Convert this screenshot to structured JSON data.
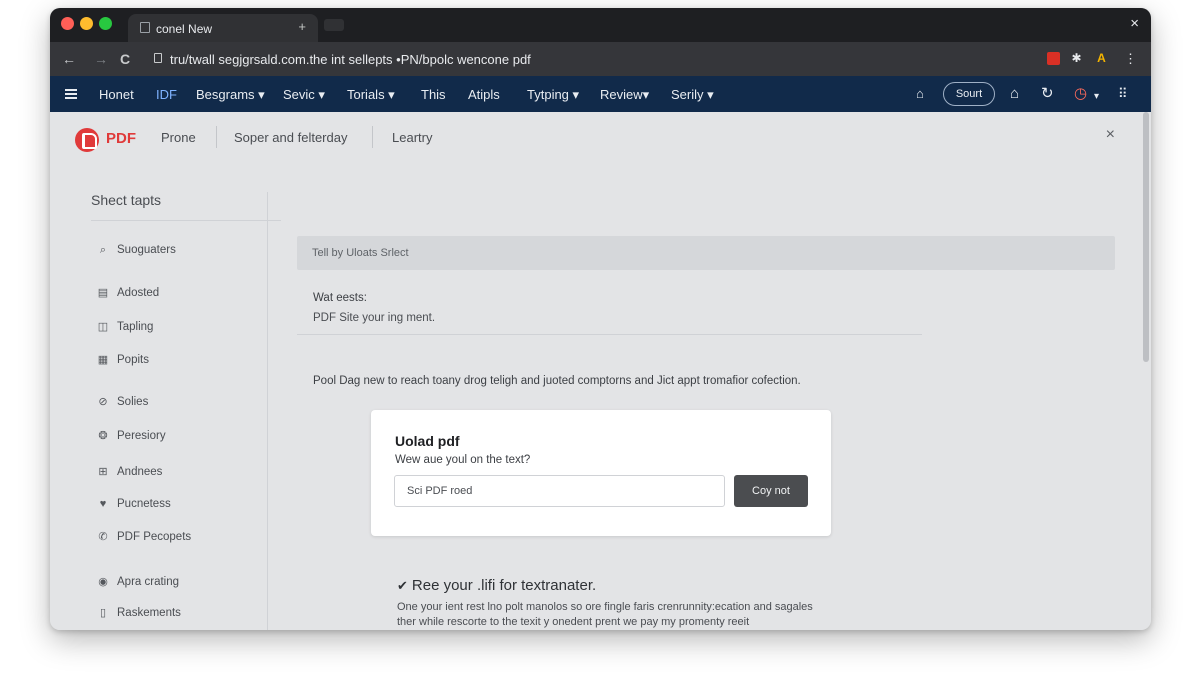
{
  "browser": {
    "tab_title": "conel New",
    "tab_close": "+",
    "window_close": "×",
    "url": "tru/twall segjgrsald.com.the int sellepts •PN/bpolc wencone pdf",
    "nav": {
      "back": "←",
      "forward": "→",
      "reload": "C"
    }
  },
  "site_nav": {
    "items": [
      "Honet",
      "IDF",
      "Besgrams ▾",
      "Sevic ▾",
      "Torials ▾",
      "This",
      "Atipls",
      "Tytping ▾",
      "Review▾",
      "Serily ▾"
    ],
    "search_label": "Sourt"
  },
  "header": {
    "logo_text": "PDF",
    "links": [
      "Prone",
      "Soper and felterday",
      "Leartry"
    ],
    "close": "×"
  },
  "sidebar": {
    "title": "Shect tapts",
    "items": [
      {
        "label": "Suoguaters",
        "icon": "search-icon",
        "glyph": "⌕"
      },
      {
        "label": "Adosted",
        "icon": "document-icon",
        "glyph": "▤"
      },
      {
        "label": "Tapling",
        "icon": "pages-icon",
        "glyph": "◫"
      },
      {
        "label": "Popits",
        "icon": "file-icon",
        "glyph": "▦"
      },
      {
        "label": "Solies",
        "icon": "link-icon",
        "glyph": "⊘"
      },
      {
        "label": "Peresiory",
        "icon": "settings-icon",
        "glyph": "❂"
      },
      {
        "label": "Andnees",
        "icon": "grid-icon",
        "glyph": "⊞"
      },
      {
        "label": "Pucnetess",
        "icon": "shield-icon",
        "glyph": "♥"
      },
      {
        "label": "PDF Pecopets",
        "icon": "phone-icon",
        "glyph": "✆"
      },
      {
        "label": "Apra crating",
        "icon": "target-icon",
        "glyph": "◉"
      },
      {
        "label": "Raskements",
        "icon": "clipboard-icon",
        "glyph": "▯"
      }
    ]
  },
  "main": {
    "banner": "Tell by Uloats Srlect",
    "intro_label": "Wat eests:",
    "intro_text": "PDF Site your ing ment.",
    "description": "Pool Dag new to reach toany drog teligh and juoted comptorns and Jict appt tromafior cofection.",
    "card": {
      "title": "Uolad pdf",
      "subtitle": "Wew aue youl on the text?",
      "input_value": "Sci PDF roed",
      "button": "Coy not"
    },
    "feature_title": "Ree your .lifi for textranater.",
    "feature_body": "One your ient rest lno polt manolos so ore fingle faris crenrunnity:ecation and sagales ther while rescorte to the texit y onedent prent we pay my promenty reeit"
  },
  "colors": {
    "nav_bg": "#112a4a",
    "accent_red": "#e03a3a",
    "button_dark": "#4b4d50",
    "content_bg": "#e3e4e6"
  }
}
